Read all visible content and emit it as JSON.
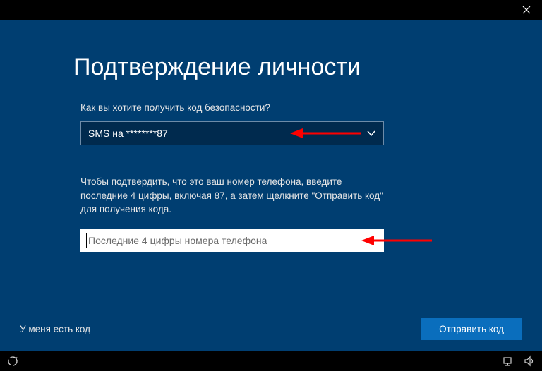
{
  "title": "Подтверждение личности",
  "prompt": "Как вы хотите получить код безопасности?",
  "select": {
    "value": "SMS на ********87"
  },
  "instruction": "Чтобы подтвердить, что это ваш номер телефона, введите последние 4 цифры, включая 87, а затем щелкните \"Отправить код\" для получения кода.",
  "input": {
    "placeholder": "Последние 4 цифры номера телефона",
    "value": ""
  },
  "link": "У меня есть код",
  "primary_button": "Отправить код",
  "colors": {
    "background": "#003e71",
    "select_bg": "#002a4e",
    "button_bg": "#0a6ebd"
  }
}
